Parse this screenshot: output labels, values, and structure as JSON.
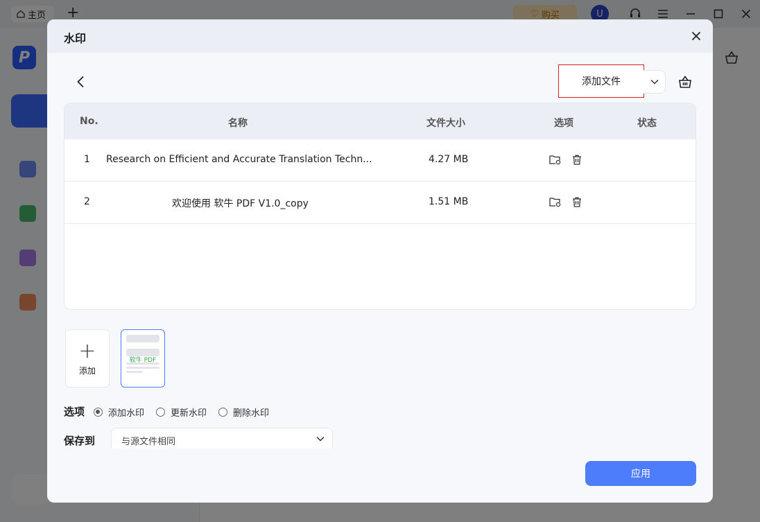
{
  "background": {
    "tab_label": "主页",
    "buy_label": "购买",
    "avatar_letter": "U"
  },
  "dialog": {
    "title": "水印",
    "add_file_label": "添加文件",
    "table": {
      "headers": {
        "no": "No.",
        "name": "名称",
        "size": "文件大小",
        "options": "选项",
        "status": "状态"
      },
      "rows": [
        {
          "no": "1",
          "name": "Research on Efficient and Accurate Translation Techn...",
          "size": "4.27 MB",
          "status": ""
        },
        {
          "no": "2",
          "name": "欢迎使用 软牛 PDF V1.0_copy",
          "size": "1.51 MB",
          "status": ""
        }
      ]
    },
    "templates": {
      "add_label": "添加",
      "card_watermark_text": "软牛 PDF"
    },
    "options": {
      "label": "选项",
      "items": [
        {
          "label": "添加水印",
          "selected": true
        },
        {
          "label": "更新水印",
          "selected": false
        },
        {
          "label": "删除水印",
          "selected": false
        }
      ]
    },
    "save_to": {
      "label": "保存到",
      "value": "与源文件相同"
    },
    "apply_label": "应用"
  },
  "colors": {
    "accent": "#4e7dfc",
    "highlight_border": "#d82020"
  }
}
